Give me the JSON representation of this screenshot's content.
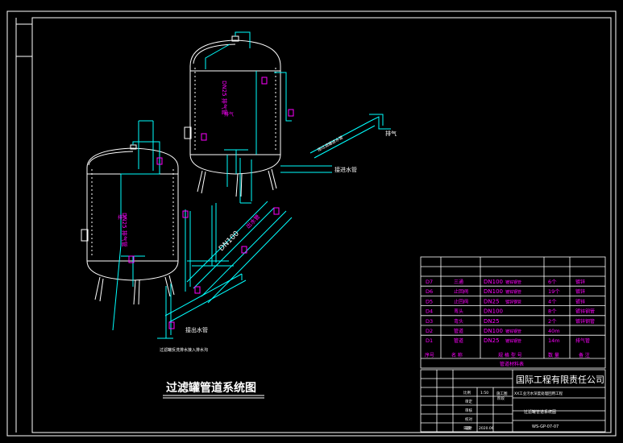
{
  "drawing_title": "过滤罐管道系统图",
  "tank_pipe_labels": {
    "left_tank_pipe": "DN25 排气管",
    "left_tank_tag": "排气",
    "right_tank_pipe": "DN25 排气管",
    "right_tank_tag": "排气",
    "main_pipe": "DN100",
    "main_pipe_tag": "出水管"
  },
  "side_labels": {
    "inlet_right": "接进水管",
    "outlet_bottom": "接出水管",
    "vent": "排气",
    "bottom_note": "过滤罐反洗排水接入排水沟",
    "diagonal_note": "接过滤罐进水管"
  },
  "material_table": {
    "rows": [
      {
        "code": "D7",
        "name": "三通",
        "spec": "DN100",
        "spec_note": "镀锌钢管",
        "qty": "6个",
        "remark": "镀锌"
      },
      {
        "code": "D6",
        "name": "止回阀",
        "spec": "DN100",
        "spec_note": "镀锌钢管",
        "qty": "19个",
        "remark": "镀锌"
      },
      {
        "code": "D5",
        "name": "止回阀",
        "spec": "DN25",
        "spec_note": "镀锌钢管",
        "qty": "4个",
        "remark": "镀锌"
      },
      {
        "code": "D4",
        "name": "弯头",
        "spec": "DN100",
        "spec_note": "",
        "qty": "8个",
        "remark": "镀锌钢管"
      },
      {
        "code": "D3",
        "name": "弯头",
        "spec": "DN25",
        "spec_note": "",
        "qty": "2个",
        "remark": "镀锌钢管"
      },
      {
        "code": "D2",
        "name": "管道",
        "spec": "DN100",
        "spec_note": "镀锌钢管",
        "qty": "40m",
        "remark": ""
      },
      {
        "code": "D1",
        "name": "管道",
        "spec": "DN25",
        "spec_note": "镀锌钢管",
        "qty": "14m",
        "remark": "排气管"
      }
    ],
    "header": {
      "code": "序号",
      "name": "名 称",
      "spec": "规 格 型 号",
      "qty": "数 量",
      "remark": "备 注"
    },
    "caption": "管道材料表"
  },
  "title_block": {
    "company": "国际工程有限责任公司",
    "project": "XX工业污水深度处理回用工程",
    "sheet_name": "过滤罐管道系统图",
    "drawing_no": "WS-GP-07-07",
    "stage_label": "施工图",
    "stage_label2": "阶段",
    "scale_label": "比例",
    "scale_value": "1:50",
    "date_label": "日期",
    "date_value": "2020.06",
    "rows": [
      "审定",
      "审核",
      "校对",
      "设计"
    ]
  },
  "colors": {
    "background": "#000000",
    "frame": "#ffffff",
    "pipe_cyan": "#00ffff",
    "label_magenta": "#ff00ff"
  }
}
